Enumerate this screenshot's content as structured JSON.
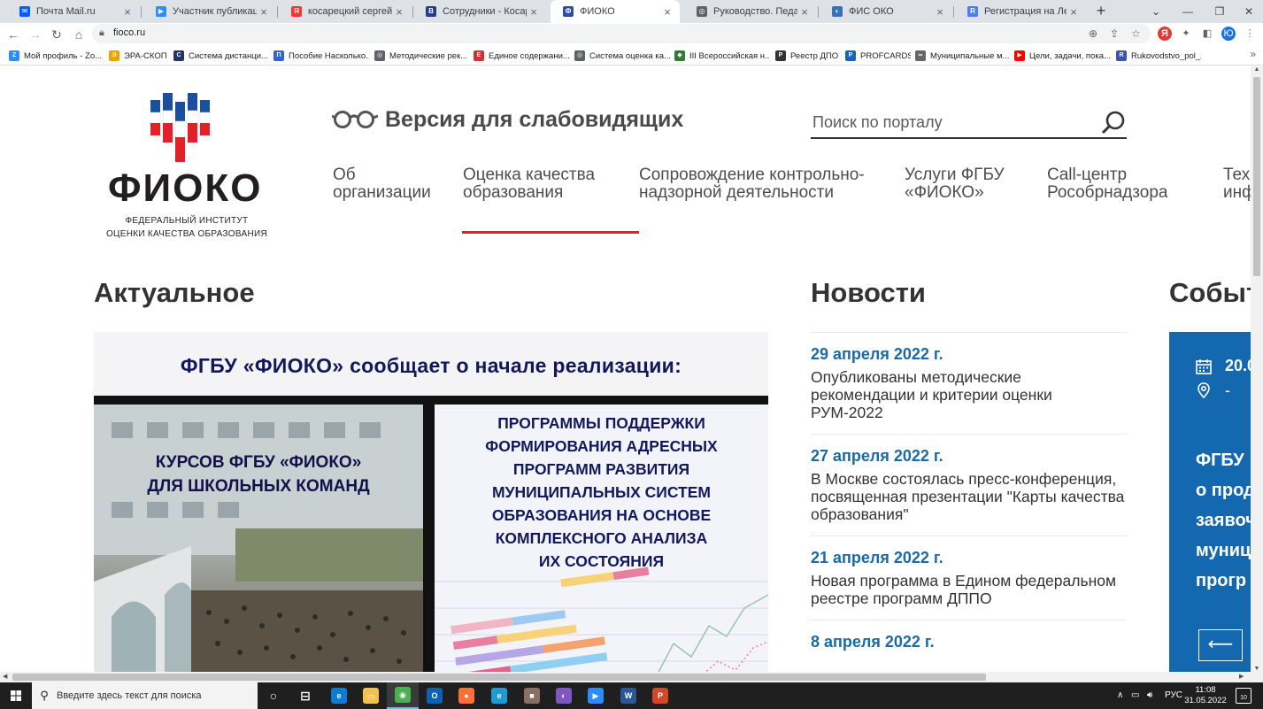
{
  "browser": {
    "tabs": [
      {
        "title": "Почта Mail.ru",
        "color": "#005ff9",
        "glyph": "✉",
        "active": false
      },
      {
        "title": "Участник публикации - Zoom",
        "color": "#2d8cff",
        "glyph": "▶",
        "active": false
      },
      {
        "title": "косарецкий сергей геннадьевич",
        "color": "#f33",
        "glyph": "Я",
        "active": false
      },
      {
        "title": "Сотрудники - Косарецкий Сергей",
        "color": "#243b8f",
        "glyph": "В",
        "active": false
      },
      {
        "title": "ФИОКО",
        "color": "#2a4fa0",
        "glyph": "Ф",
        "active": true
      },
      {
        "title": "Руководство. Педагогический",
        "color": "#5f6368",
        "glyph": "◎",
        "active": false
      },
      {
        "title": "ФИС ОКО",
        "color": "#3b6fb6",
        "glyph": "◐",
        "active": false
      },
      {
        "title": "Регистрация на Летнюю школу",
        "color": "#4e7df1",
        "glyph": "R",
        "active": false
      }
    ],
    "new_tab": "+",
    "url": "fioco.ru",
    "profile_letter": "Ю",
    "bookmarks": [
      {
        "label": "Мой профиль - Zo...",
        "color": "#2d8cff",
        "glyph": "Z"
      },
      {
        "label": "ЭРА-СКОП",
        "color": "#f0a000",
        "glyph": "Э"
      },
      {
        "label": "Система дистанци...",
        "color": "#223366",
        "glyph": "С"
      },
      {
        "label": "Пособие Насколько...",
        "color": "#3366cc",
        "glyph": "П"
      },
      {
        "label": "Методические рек...",
        "color": "#5f6368",
        "glyph": "◎"
      },
      {
        "label": "Единое содержани...",
        "color": "#cc3333",
        "glyph": "Е"
      },
      {
        "label": "Система оценка ка...",
        "color": "#5f6368",
        "glyph": "◎"
      },
      {
        "label": "III Всероссийская н...",
        "color": "#2e7d32",
        "glyph": "◆"
      },
      {
        "label": "Реестр ДПО",
        "color": "#333333",
        "glyph": "Р"
      },
      {
        "label": "PROFCARDS",
        "color": "#1565c0",
        "glyph": "P"
      },
      {
        "label": "Муниципальные м...",
        "color": "#666666",
        "glyph": "∞"
      },
      {
        "label": "Цели, задачи, пока...",
        "color": "#ff0000",
        "glyph": "▶"
      },
      {
        "label": "Rukovodstvo_pol_z...",
        "color": "#3f51b5",
        "glyph": "R"
      }
    ],
    "bookmarks_more": "»"
  },
  "site": {
    "logo_text": "ФИОКО",
    "logo_sub_line1": "ФЕДЕРАЛЬНЫЙ ИНСТИТУТ",
    "logo_sub_line2": "ОЦЕНКИ КАЧЕСТВА ОБРАЗОВАНИЯ",
    "low_vision": "Версия для слабовидящих",
    "search_placeholder": "Поиск по порталу",
    "menu": [
      {
        "label": "Об\nорганизации",
        "active": false
      },
      {
        "label": "Оценка качества\nобразования",
        "active": true
      },
      {
        "label": "Сопровождение контрольно-\nнадзорной деятельности",
        "active": false
      },
      {
        "label": "Услуги ФГБУ\n«ФИОКО»",
        "active": false
      },
      {
        "label": "Call-центр\nРособрнадзора",
        "active": false
      },
      {
        "label": "Тех\nинф",
        "active": false
      }
    ],
    "sections": {
      "current": "Актуальное",
      "news": "Новости",
      "events": "Событ"
    },
    "banner": {
      "headline": "ФГБУ «ФИОКО» сообщает о начале реализации:",
      "left": "КУРСОВ ФГБУ «ФИОКО»\nДЛЯ ШКОЛЬНЫХ КОМАНД",
      "right": "ПРОГРАММЫ ПОДДЕРЖКИ\nФОРМИРОВАНИЯ АДРЕСНЫХ\nПРОГРАММ РАЗВИТИЯ\nМУНИЦИПАЛЬНЫХ СИСТЕМ\nОБРАЗОВАНИЯ НА ОСНОВЕ\nКОМПЛЕКСНОГО АНАЛИЗА\nИХ СОСТОЯНИЯ"
    },
    "news": [
      {
        "date": "29 апреля 2022 г.",
        "text": "Опубликованы методические рекомендации и критерии оценки РУМ-2022"
      },
      {
        "date": "27 апреля 2022 г.",
        "text": "В Москве состоялась пресс-конференция, посвященная презентации \"Карты качества образования\""
      },
      {
        "date": "21 апреля 2022 г.",
        "text": "Новая программа в Едином федеральном реестре программ ДППО"
      },
      {
        "date": "8 апреля 2022 г.",
        "text": ""
      }
    ],
    "event": {
      "date": "20.0",
      "place": "-",
      "text": "ФГБУ\nо прод\nзаявоч\nмуниц\nпрогр",
      "prev": "⟵"
    }
  },
  "taskbar": {
    "search_placeholder": "Введите здесь текст для поиска",
    "apps": [
      {
        "name": "task-view",
        "color": "#1f1f1f",
        "glyph": "○"
      },
      {
        "name": "multitask",
        "color": "#1f1f1f",
        "glyph": "⊟"
      },
      {
        "name": "edge",
        "color": "#0a7cd6",
        "glyph": "e"
      },
      {
        "name": "explorer",
        "color": "#f2c14e",
        "glyph": "▭"
      },
      {
        "name": "chrome",
        "color": "#4caf50",
        "glyph": "◉"
      },
      {
        "name": "outlook",
        "color": "#0b62b5",
        "glyph": "O"
      },
      {
        "name": "firefox",
        "color": "#ff7139",
        "glyph": "●"
      },
      {
        "name": "ie",
        "color": "#1e9ad6",
        "glyph": "e"
      },
      {
        "name": "app-brown",
        "color": "#8d6e63",
        "glyph": "■"
      },
      {
        "name": "app-purple",
        "color": "#7e57c2",
        "glyph": "◐"
      },
      {
        "name": "zoom",
        "color": "#2d8cff",
        "glyph": "▶"
      },
      {
        "name": "word",
        "color": "#2b5797",
        "glyph": "W"
      },
      {
        "name": "powerpoint",
        "color": "#d24726",
        "glyph": "P"
      }
    ],
    "tray_lang": "РУС",
    "time": "11:08",
    "date": "31.05.2022",
    "notifications": "10"
  }
}
